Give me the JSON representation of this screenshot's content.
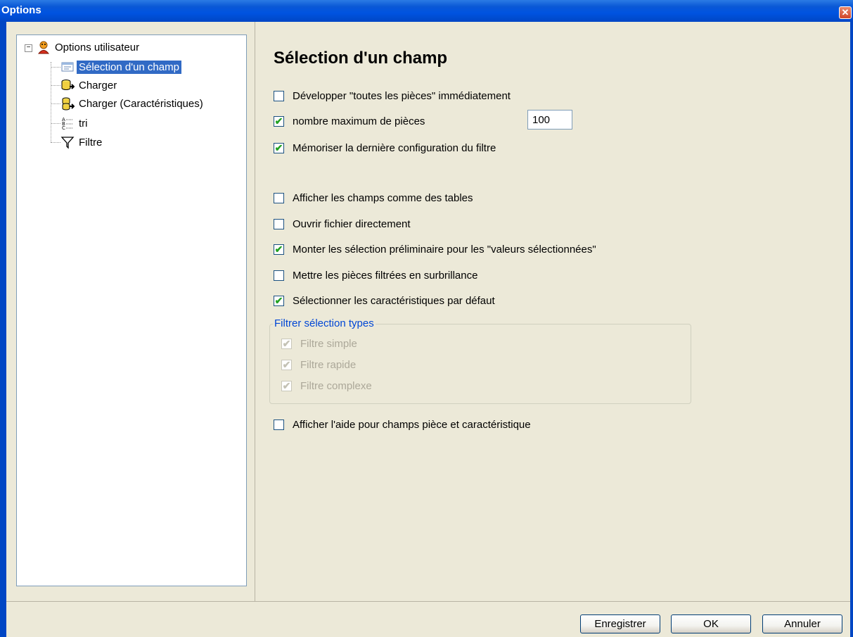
{
  "window": {
    "title": "Options",
    "close_glyph": "✕"
  },
  "tree": {
    "root": {
      "label": "Options utilisateur",
      "icon": "user-icon",
      "expander": "−"
    },
    "items": [
      {
        "label": "Sélection d'un champ",
        "icon": "field-selection-icon"
      },
      {
        "label": "Charger",
        "icon": "database-load-icon"
      },
      {
        "label": "Charger (Caractéristiques)",
        "icon": "database-characteristics-icon"
      },
      {
        "label": "tri",
        "icon": "sort-icon"
      },
      {
        "label": "Filtre",
        "icon": "filter-icon"
      }
    ]
  },
  "main": {
    "heading": "Sélection d'un champ",
    "options": [
      {
        "label": "Développer \"toutes les pièces\" immédiatement",
        "checked": false
      },
      {
        "label": "nombre maximum de pièces",
        "checked": true
      },
      {
        "label": "Mémoriser la dernière configuration du filtre",
        "checked": true
      },
      {
        "label": "Afficher les champs comme des tables",
        "checked": false
      },
      {
        "label": "Ouvrir fichier directement",
        "checked": false
      },
      {
        "label": "Monter les sélection préliminaire pour les \"valeurs sélectionnées\"",
        "checked": true
      },
      {
        "label": "Mettre les pièces filtrées en surbrillance",
        "checked": false
      },
      {
        "label": "Sélectionner les caractéristiques par défaut",
        "checked": true
      }
    ],
    "max_parts_value": "100",
    "filter_group": {
      "title": "Filtrer sélection types",
      "items": [
        {
          "label": "Filtre simple",
          "checked": true,
          "enabled": false
        },
        {
          "label": "Filtre rapide",
          "checked": true,
          "enabled": false
        },
        {
          "label": "Filtre complexe",
          "checked": true,
          "enabled": false
        }
      ]
    },
    "help_option": {
      "label": "Afficher l'aide pour champs pièce et caractéristique",
      "checked": false
    }
  },
  "footer": {
    "save_label": "Enregistrer",
    "ok_label": "OK",
    "cancel_label": "Annuler"
  },
  "colors": {
    "selection": "#316ac5",
    "check": "#21a121",
    "group_title": "#0046d5",
    "titlebar": "#0053e0"
  }
}
